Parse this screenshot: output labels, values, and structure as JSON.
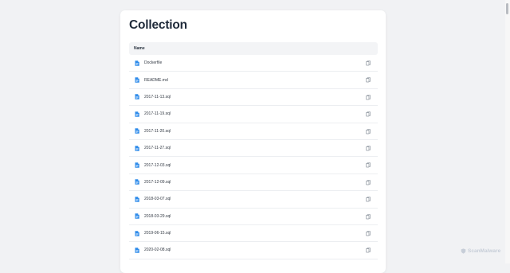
{
  "page": {
    "title": "Collection"
  },
  "table": {
    "header": "Name",
    "rows": [
      {
        "name": "Dockerfile"
      },
      {
        "name": "README.md"
      },
      {
        "name": "2017-11-13.sql"
      },
      {
        "name": "2017-11-19.sql"
      },
      {
        "name": "2017-11-20.sql"
      },
      {
        "name": "2017-11-27.sql"
      },
      {
        "name": "2017-12-03.sql"
      },
      {
        "name": "2017-12-09.sql"
      },
      {
        "name": "2018-03-07.sql"
      },
      {
        "name": "2018-03-29.sql"
      },
      {
        "name": "2019-06-15.sql"
      },
      {
        "name": "2020-02-08.sql"
      }
    ]
  },
  "watermark": {
    "text": "ScanMalware"
  },
  "colors": {
    "file_icon": "#2e8bea",
    "copy_icon": "#8a929c"
  },
  "icons": {
    "file": "file-icon",
    "copy": "copy-icon"
  }
}
